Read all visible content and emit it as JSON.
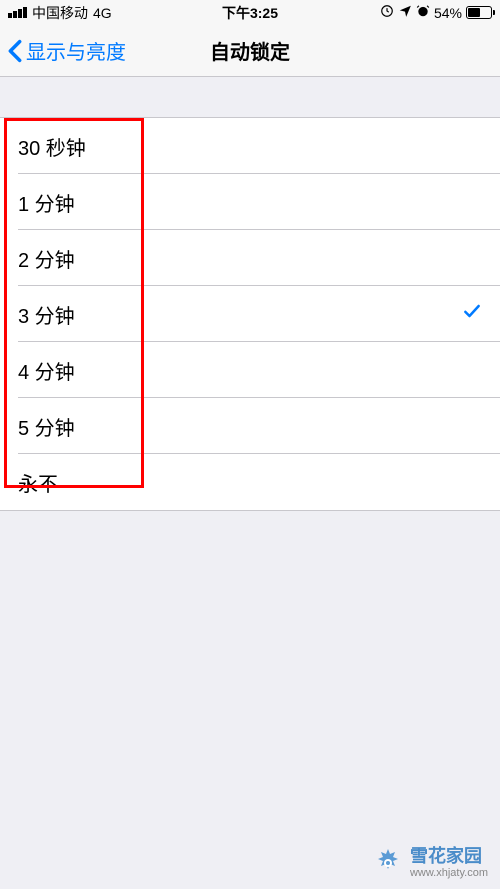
{
  "statusBar": {
    "carrier": "中国移动",
    "network": "4G",
    "time": "下午3:25",
    "batteryPercent": "54%"
  },
  "navBar": {
    "backLabel": "显示与亮度",
    "title": "自动锁定"
  },
  "options": [
    {
      "label": "30 秒钟",
      "selected": false
    },
    {
      "label": "1 分钟",
      "selected": false
    },
    {
      "label": "2 分钟",
      "selected": false
    },
    {
      "label": "3 分钟",
      "selected": true
    },
    {
      "label": "4 分钟",
      "selected": false
    },
    {
      "label": "5 分钟",
      "selected": false
    },
    {
      "label": "永不",
      "selected": false
    }
  ],
  "watermark": {
    "title": "雪花家园",
    "url": "www.xhjaty.com"
  }
}
